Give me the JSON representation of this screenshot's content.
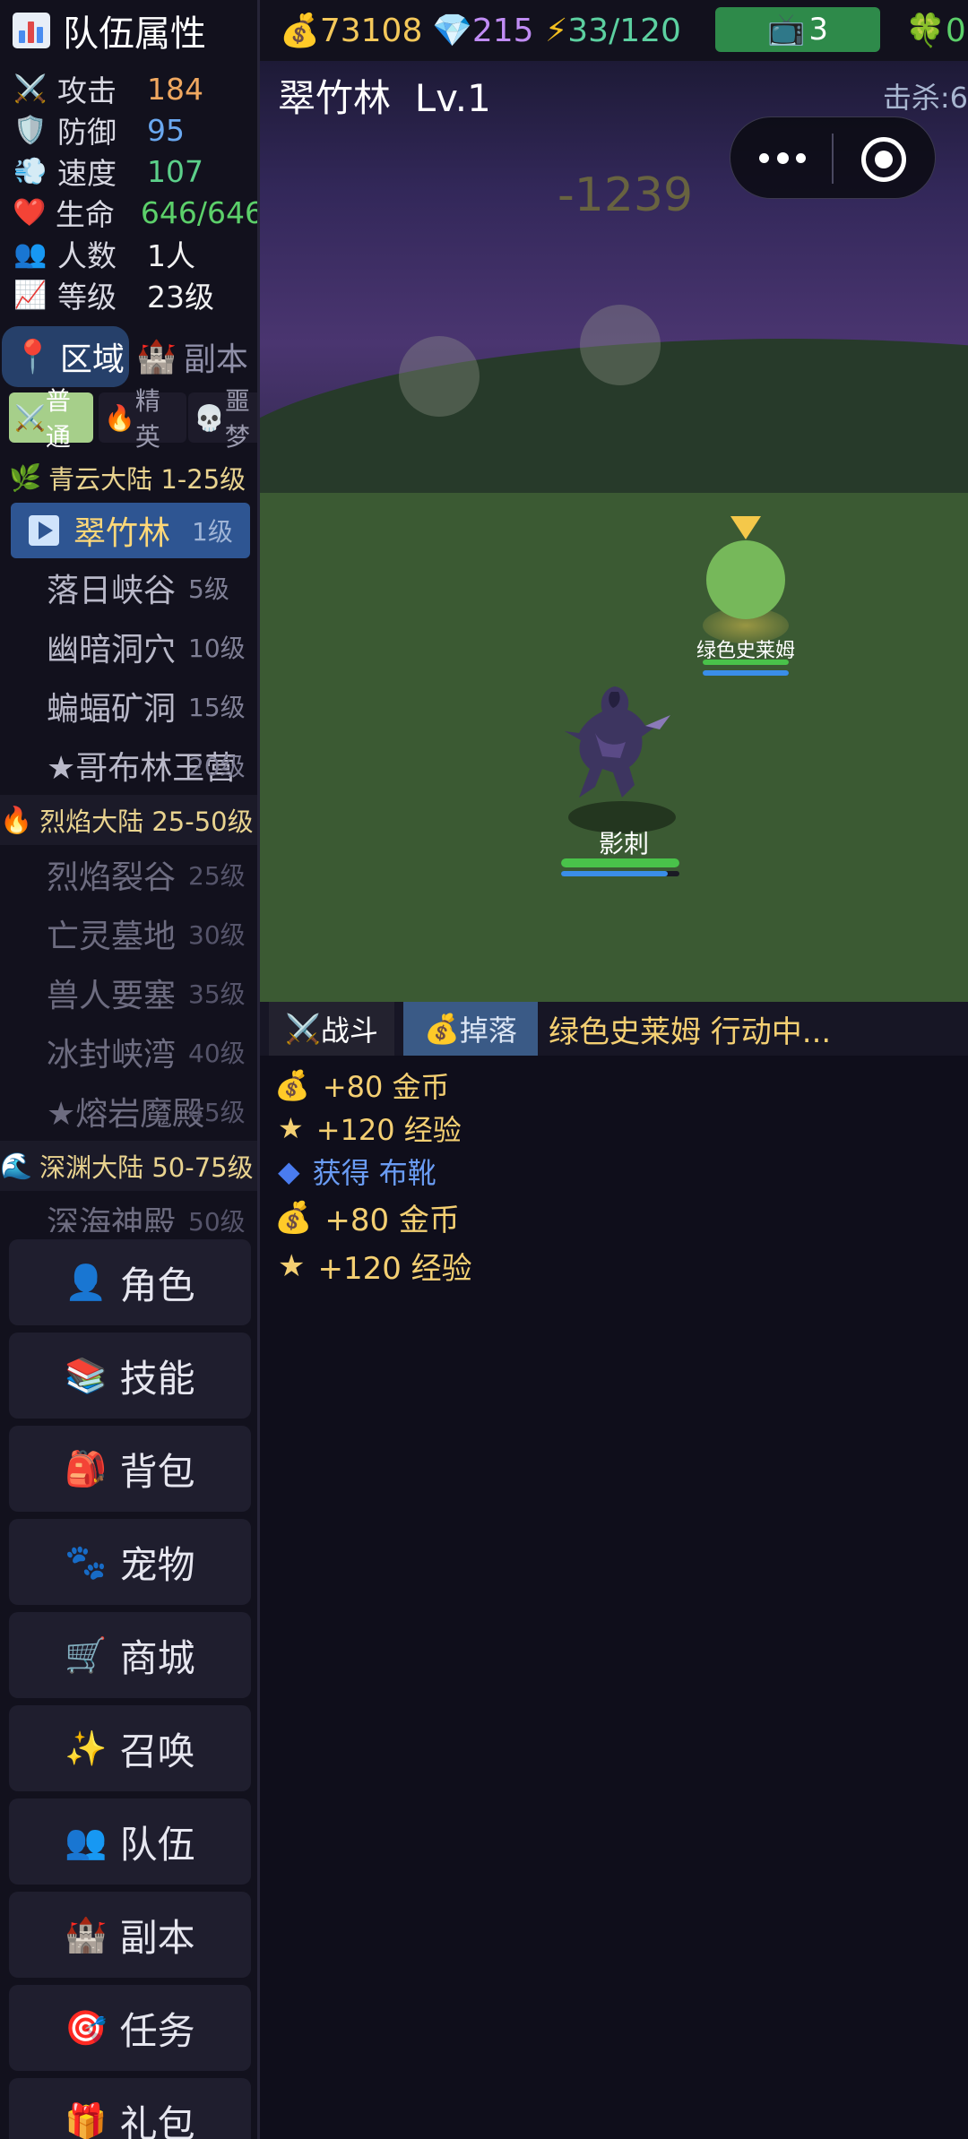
{
  "team": {
    "title": "队伍属性",
    "icon": "bar-chart-icon"
  },
  "stats": [
    {
      "icon": "⚔️",
      "label": "攻击",
      "value": "184",
      "color": "#f0a860"
    },
    {
      "icon": "🛡️",
      "label": "防御",
      "value": "95",
      "color": "#6aa8f0"
    },
    {
      "icon": "💨",
      "label": "速度",
      "value": "107",
      "color": "#5cd08a"
    },
    {
      "icon": "❤️",
      "label": "生命",
      "value": "646/646",
      "color": "#5cd06a"
    },
    {
      "icon": "👥",
      "label": "人数",
      "value": "1人",
      "color": "#f2f2f2"
    },
    {
      "icon": "📈",
      "label": "等级",
      "value": "23级",
      "color": "#f2f2f2"
    }
  ],
  "area_tabs": {
    "active": "区域",
    "inactive": "副本"
  },
  "difficulty_tabs": [
    "普通",
    "精英",
    "噩梦"
  ],
  "regions": [
    {
      "title": "青云大陆 1-25级",
      "zones": [
        {
          "name": "翠竹林",
          "level": "1级",
          "current": true
        },
        {
          "name": "落日峡谷",
          "level": "5级"
        },
        {
          "name": "幽暗洞穴",
          "level": "10级"
        },
        {
          "name": "蝙蝠矿洞",
          "level": "15级"
        },
        {
          "name": "★哥布林王营",
          "level": "20级"
        }
      ]
    },
    {
      "title": "烈焰大陆 25-50级",
      "zones": [
        {
          "name": "烈焰裂谷",
          "level": "25级"
        },
        {
          "name": "亡灵墓地",
          "level": "30级"
        },
        {
          "name": "兽人要塞",
          "level": "35级"
        },
        {
          "name": "冰封峡湾",
          "level": "40级"
        },
        {
          "name": "★熔岩魔殿",
          "level": "45级"
        }
      ]
    },
    {
      "title": "深渊大陆 50-75级",
      "zones": [
        {
          "name": "深海神殿",
          "level": "50级"
        }
      ]
    }
  ],
  "menu": [
    {
      "icon": "👤",
      "label": "角色"
    },
    {
      "icon": "📚",
      "label": "技能"
    },
    {
      "icon": "🎒",
      "label": "背包"
    },
    {
      "icon": "🐾",
      "label": "宠物"
    },
    {
      "icon": "🛒",
      "label": "商城"
    },
    {
      "icon": "✨",
      "label": "召唤"
    },
    {
      "icon": "👥",
      "label": "队伍"
    },
    {
      "icon": "🏰",
      "label": "副本"
    },
    {
      "icon": "🎯",
      "label": "任务"
    },
    {
      "icon": "🎁",
      "label": "礼包"
    }
  ],
  "resources": {
    "gold": "73108",
    "diamonds": "215",
    "energy": "33/120",
    "tv": "3",
    "clover": "0"
  },
  "scene": {
    "zone_title": "翠竹林",
    "zone_level": "Lv.1",
    "kills_label": "击杀:6",
    "damage": "-1239",
    "enemy_name": "绿色史莱姆",
    "enemy_hp": 1.0,
    "enemy_mp": 1.0,
    "hero_name": "影刺",
    "hero_hp": 1.0,
    "hero_mp": 0.9
  },
  "log_tabs": {
    "battle": "战斗",
    "drops": "掉落"
  },
  "log_status": "绿色史莱姆 行动中...",
  "log": [
    {
      "icon": "💰",
      "text": "+80 金币",
      "color": "#f4cf72"
    },
    {
      "icon": "★",
      "text": "+120 经验",
      "color": "#f4cf72"
    },
    {
      "icon": "◆",
      "text": "获得 布靴",
      "color": "#6a9cf4"
    },
    {
      "icon": "💰",
      "text": "+80 金币",
      "color": "#f4cf72"
    },
    {
      "icon": "★",
      "text": "+120 经验",
      "color": "#f4cf72"
    }
  ]
}
